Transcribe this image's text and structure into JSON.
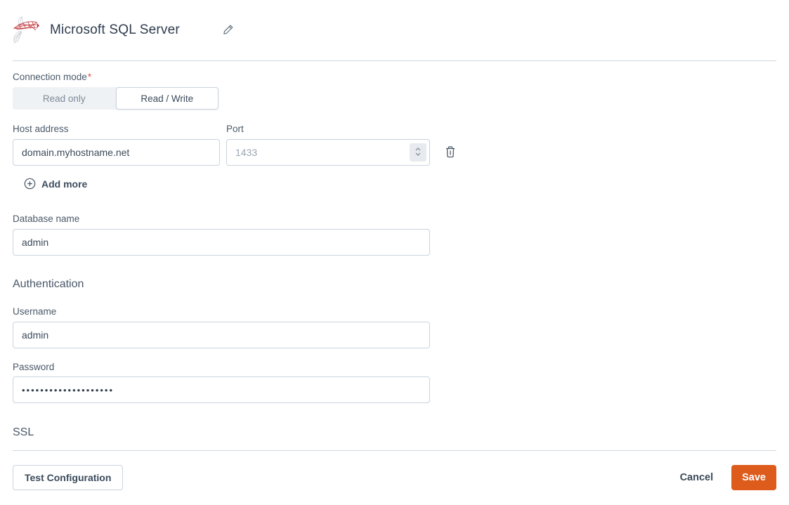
{
  "header": {
    "title": "Microsoft SQL Server"
  },
  "connection_mode": {
    "label": "Connection mode",
    "required_marker": "*",
    "options": [
      {
        "label": "Read only",
        "selected": false
      },
      {
        "label": "Read / Write",
        "selected": true
      }
    ]
  },
  "hosts": {
    "host_label": "Host address",
    "host_value": "domain.myhostname.net",
    "port_label": "Port",
    "port_placeholder": "1433",
    "add_more_label": "Add more"
  },
  "database": {
    "label": "Database name",
    "value": "admin"
  },
  "authentication": {
    "heading": "Authentication",
    "username_label": "Username",
    "username_value": "admin",
    "password_label": "Password",
    "password_value": "••••••••••••••••••••"
  },
  "ssl": {
    "heading": "SSL"
  },
  "footer": {
    "test_label": "Test Configuration",
    "cancel_label": "Cancel",
    "save_label": "Save"
  },
  "colors": {
    "save_orange": "#DD5B1B",
    "required_red": "#E0514C",
    "title_text": "#2D3C4E",
    "label_text": "#4A5868",
    "input_border": "#C9D3DD",
    "divider": "#CED7DF",
    "segment_bg": "#EFF2F5",
    "logo_red": "#BF3338"
  }
}
